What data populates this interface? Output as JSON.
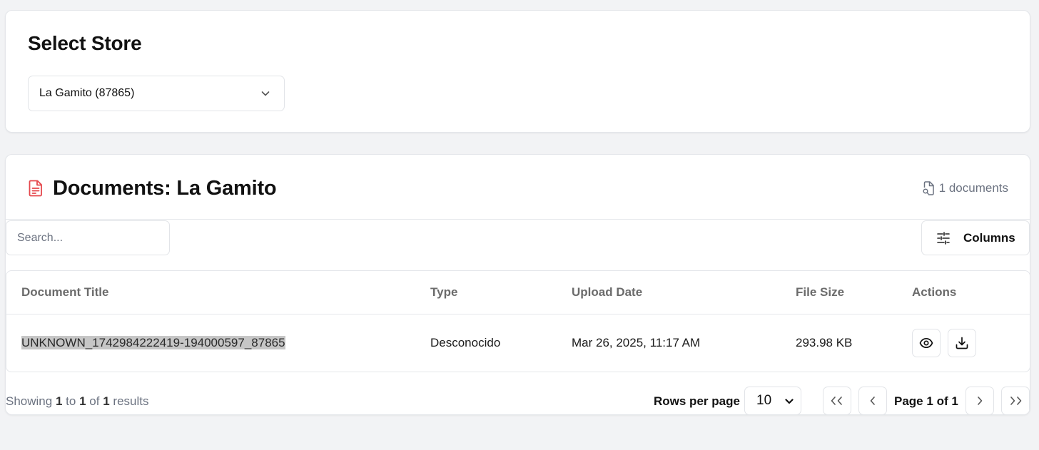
{
  "store_section": {
    "title": "Select Store",
    "selected_store": "La Gamito (87865)"
  },
  "documents_section": {
    "title": "Documents: La Gamito",
    "count_label": "1 documents",
    "search_placeholder": "Search...",
    "columns_label": "Columns",
    "table": {
      "headers": [
        "Document Title",
        "Type",
        "Upload Date",
        "File Size",
        "Actions"
      ],
      "rows": [
        {
          "title": "UNKNOWN_1742984222419-194000597_87865",
          "type": "Desconocido",
          "upload_date": "Mar 26, 2025, 11:17 AM",
          "file_size": "293.98 KB"
        }
      ]
    },
    "footer": {
      "showing_prefix": "Showing",
      "from": "1",
      "to_word": "to",
      "to": "1",
      "of_word": "of",
      "total": "1",
      "results_word": "results",
      "rows_per_page_label": "Rows per page",
      "rows_per_page_value": "10",
      "page_word": "Page",
      "current_page": "1",
      "page_of_word": "of",
      "total_pages": "1"
    }
  },
  "icons": {
    "store_dropdown": "chevron-down-icon",
    "documents_header": "file-text-icon",
    "document_count": "file-search-icon",
    "columns": "sliders-icon",
    "view": "eye-icon",
    "download": "download-icon"
  },
  "colors": {
    "accent_red": "#e5484d",
    "background": "#f2f3f5",
    "muted_text": "#6b7280"
  }
}
